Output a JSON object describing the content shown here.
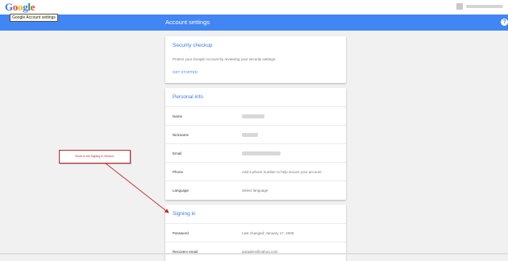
{
  "logo": "Google",
  "tooltip": "Google Account settings",
  "header": {
    "title": "Account settings",
    "help_icon": "?"
  },
  "security_checkup": {
    "title": "Security checkup",
    "description": "Protect your Google Account by reviewing your security settings.",
    "action": "GET STARTED"
  },
  "personal_info": {
    "title": "Personal info",
    "rows": [
      {
        "label": "Name"
      },
      {
        "label": "Nickname"
      },
      {
        "label": "Email"
      },
      {
        "label": "Phone",
        "value": "Add a phone number to help secure your account"
      },
      {
        "label": "Language",
        "value": "Select language"
      }
    ]
  },
  "signing_in": {
    "title": "Signing in",
    "rows": [
      {
        "label": "Password",
        "value": "Last changed: January 17, 2008"
      },
      {
        "label": "Recovery email",
        "value": "agraders@yahoo.com"
      }
    ]
  },
  "annotation": {
    "text": "Scroll to the Signing In Section.",
    "color": "#c62828"
  },
  "colors": {
    "accent": "#4285f4",
    "title_blue": "#3b78e7"
  }
}
